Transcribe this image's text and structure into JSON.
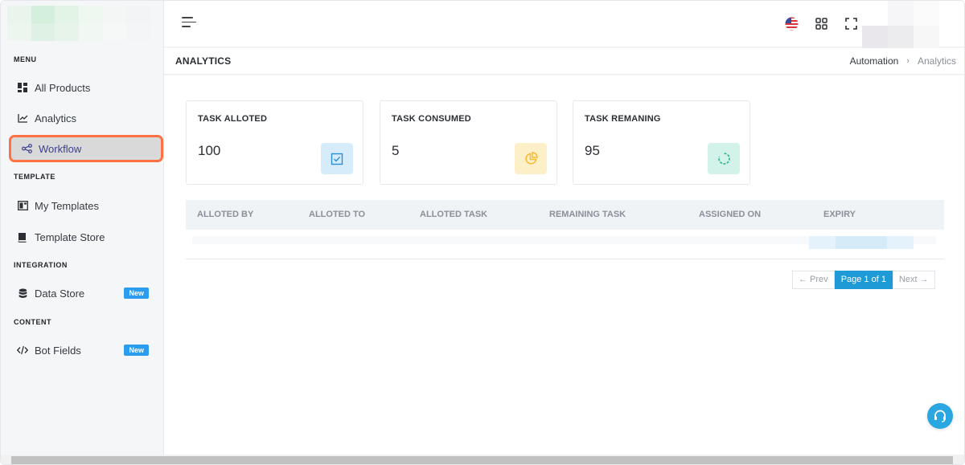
{
  "sidebar": {
    "sections": {
      "menu": "MENU",
      "template": "TEMPLATE",
      "integration": "INTEGRATION",
      "content": "CONTENT"
    },
    "items": {
      "all_products": "All Products",
      "analytics": "Analytics",
      "workflow": "Workflow",
      "my_templates": "My Templates",
      "template_store": "Template Store",
      "data_store": "Data Store",
      "bot_fields": "Bot Fields"
    },
    "badges": {
      "data_store": "New",
      "bot_fields": "New"
    }
  },
  "header": {
    "page_title": "ANALYTICS",
    "breadcrumb": [
      "Automation",
      "Analytics"
    ]
  },
  "cards": [
    {
      "label": "TASK ALLOTED",
      "value": "100",
      "icon": "check-square-icon",
      "color": "#d7ecfb"
    },
    {
      "label": "TASK CONSUMED",
      "value": "5",
      "icon": "pie-chart-icon",
      "color": "#fdf0c8"
    },
    {
      "label": "TASK REMANING",
      "value": "95",
      "icon": "loader-icon",
      "color": "#d3f2ea"
    }
  ],
  "table": {
    "headers": [
      "ALLOTED BY",
      "ALLOTED TO",
      "ALLOTED TASK",
      "REMAINING TASK",
      "ASSIGNED ON",
      "EXPIRY"
    ]
  },
  "pagination": {
    "prev": "← Prev",
    "current": "Page 1 of 1",
    "next": "Next →"
  },
  "colors": {
    "accent": "#1e9ad6",
    "highlight_border": "#ff7043",
    "badge": "#2b9cf0"
  }
}
